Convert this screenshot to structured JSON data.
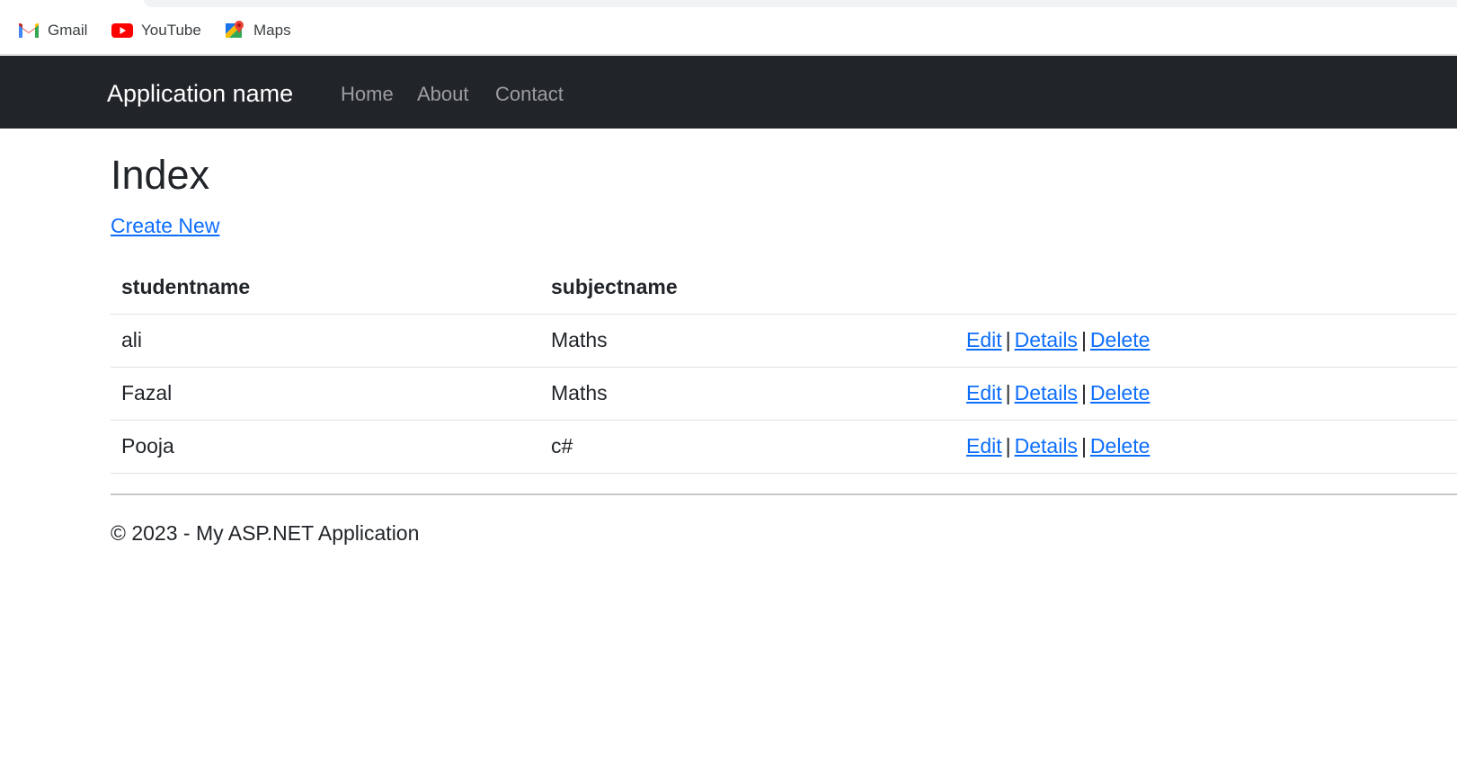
{
  "bookmarks": [
    {
      "label": "Gmail",
      "icon": "gmail-icon"
    },
    {
      "label": "YouTube",
      "icon": "youtube-icon"
    },
    {
      "label": "Maps",
      "icon": "maps-icon"
    }
  ],
  "navbar": {
    "brand": "Application name",
    "links": [
      "Home",
      "About",
      "Contact"
    ]
  },
  "page": {
    "title": "Index",
    "create_new": "Create New"
  },
  "table": {
    "headers": [
      "studentname",
      "subjectname"
    ],
    "rows": [
      {
        "studentname": "ali",
        "subjectname": "Maths"
      },
      {
        "studentname": "Fazal",
        "subjectname": "Maths"
      },
      {
        "studentname": "Pooja",
        "subjectname": "c#"
      }
    ],
    "actions": {
      "edit": "Edit",
      "details": "Details",
      "delete": "Delete",
      "separator": "|"
    }
  },
  "footer": {
    "text": "© 2023 - My ASP.NET Application"
  },
  "colors": {
    "navbar_bg": "#212529",
    "link": "#0d6efd",
    "nav_link": "rgba(255,255,255,0.55)"
  }
}
